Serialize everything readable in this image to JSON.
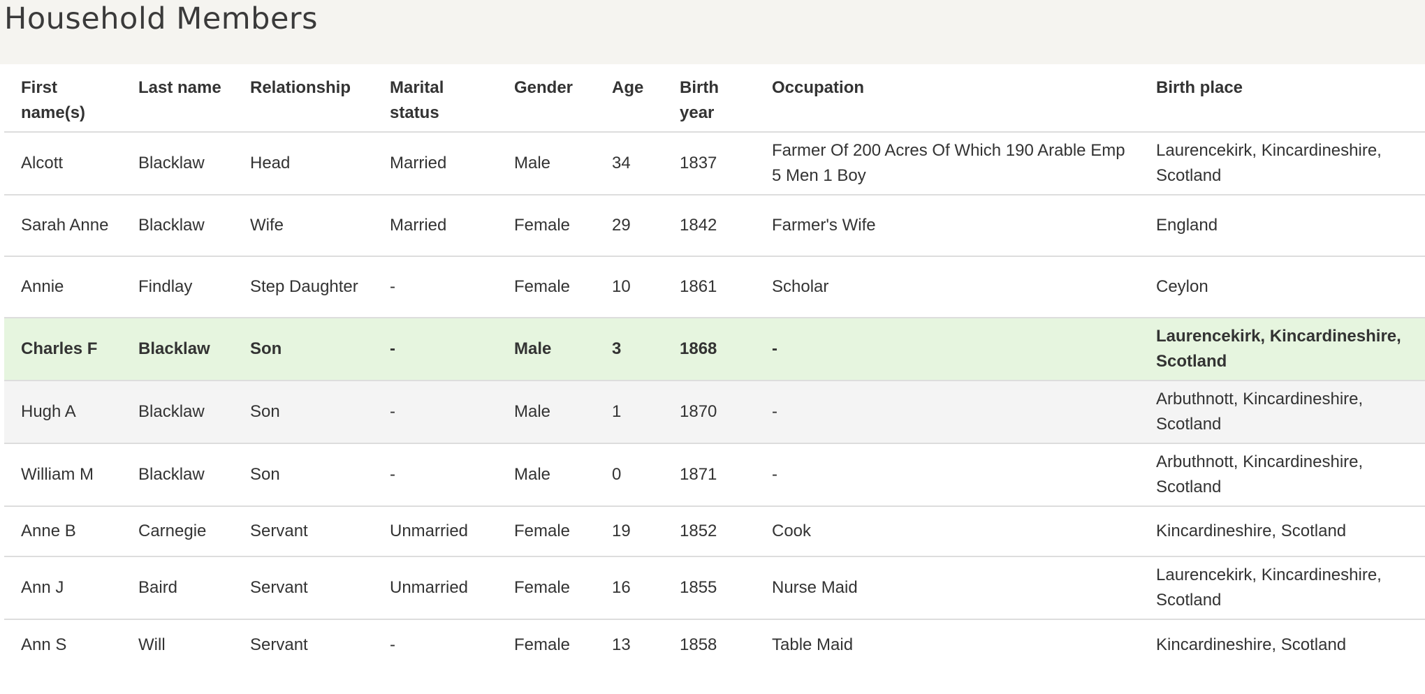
{
  "page": {
    "title": "Household Members"
  },
  "columns": {
    "first_name": "First name(s)",
    "last_name": "Last name",
    "relationship": "Relationship",
    "marital_status": "Marital status",
    "gender": "Gender",
    "age": "Age",
    "birth_year": "Birth year",
    "occupation": "Occupation",
    "birth_place": "Birth place"
  },
  "rows": [
    {
      "first_name": "Alcott",
      "last_name": "Blacklaw",
      "relationship": "Head",
      "marital_status": "Married",
      "gender": "Male",
      "age": "34",
      "birth_year": "1837",
      "occupation": "Farmer Of 200 Acres Of Which 190 Arable Emp 5 Men 1 Boy",
      "birth_place": "Laurencekirk, Kincardineshire, Scotland"
    },
    {
      "first_name": "Sarah Anne",
      "last_name": "Blacklaw",
      "relationship": "Wife",
      "marital_status": "Married",
      "gender": "Female",
      "age": "29",
      "birth_year": "1842",
      "occupation": "Farmer's Wife",
      "birth_place": "England"
    },
    {
      "first_name": "Annie",
      "last_name": "Findlay",
      "relationship": "Step Daughter",
      "marital_status": "-",
      "gender": "Female",
      "age": "10",
      "birth_year": "1861",
      "occupation": "Scholar",
      "birth_place": "Ceylon"
    },
    {
      "first_name": "Charles F",
      "last_name": "Blacklaw",
      "relationship": "Son",
      "marital_status": "-",
      "gender": "Male",
      "age": "3",
      "birth_year": "1868",
      "occupation": "-",
      "birth_place": "Laurencekirk, Kincardineshire, Scotland"
    },
    {
      "first_name": "Hugh A",
      "last_name": "Blacklaw",
      "relationship": "Son",
      "marital_status": "-",
      "gender": "Male",
      "age": "1",
      "birth_year": "1870",
      "occupation": "-",
      "birth_place": "Arbuthnott, Kincardineshire, Scotland"
    },
    {
      "first_name": "William M",
      "last_name": "Blacklaw",
      "relationship": "Son",
      "marital_status": "-",
      "gender": "Male",
      "age": "0",
      "birth_year": "1871",
      "occupation": "-",
      "birth_place": "Arbuthnott, Kincardineshire, Scotland"
    },
    {
      "first_name": "Anne B",
      "last_name": "Carnegie",
      "relationship": "Servant",
      "marital_status": "Unmarried",
      "gender": "Female",
      "age": "19",
      "birth_year": "1852",
      "occupation": "Cook",
      "birth_place": "Kincardineshire, Scotland"
    },
    {
      "first_name": "Ann J",
      "last_name": "Baird",
      "relationship": "Servant",
      "marital_status": "Unmarried",
      "gender": "Female",
      "age": "16",
      "birth_year": "1855",
      "occupation": "Nurse Maid",
      "birth_place": "Laurencekirk, Kincardineshire, Scotland"
    },
    {
      "first_name": "Ann S",
      "last_name": "Will",
      "relationship": "Servant",
      "marital_status": "-",
      "gender": "Female",
      "age": "13",
      "birth_year": "1858",
      "occupation": "Table Maid",
      "birth_place": "Kincardineshire, Scotland"
    }
  ],
  "colors": {
    "header_bg": "#f5f4f0",
    "highlight_row_bg": "#e6f5df",
    "shaded_row_bg": "#f4f4f4",
    "border": "#dddddd"
  }
}
